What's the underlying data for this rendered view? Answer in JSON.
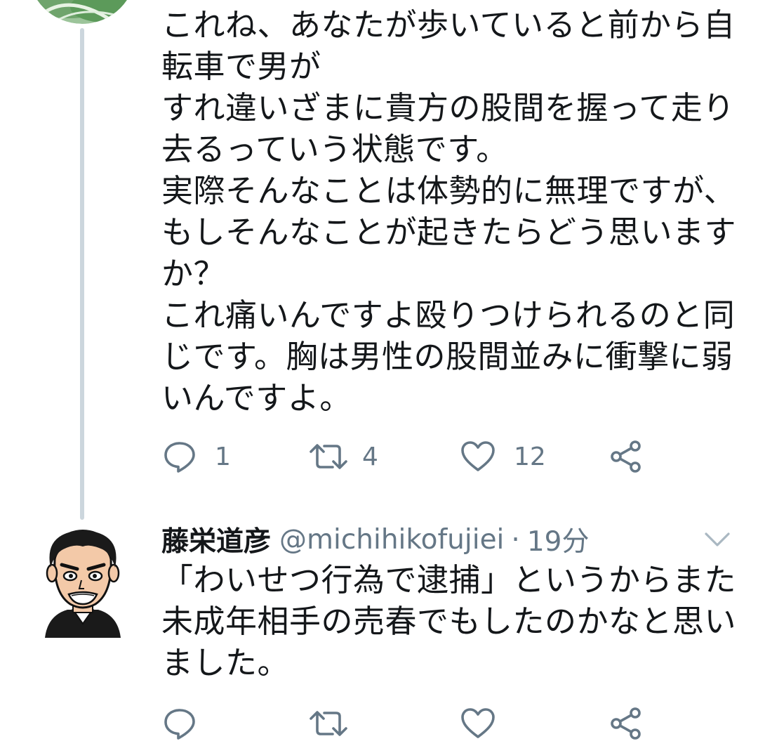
{
  "tweet1": {
    "text": "これね、あなたが歩いていると前から自\n転車で男が\nすれ違いざまに貴方の股間を握って走り\n去るっていう状態です。\n実際そんなことは体勢的に無理ですが、\nもしそんなことが起きたらどう思います\nか？\nこれ痛いんですよ殴りつけられるのと同\nじです。胸は男性の股間並みに衝撃に弱\nいんですよ。",
    "actions": {
      "reply_count": "1",
      "retweet_count": "4",
      "like_count": "12"
    }
  },
  "tweet2": {
    "display_name": "藤栄道彦",
    "handle": "@michihikofujiei",
    "separator": "·",
    "time": "19分",
    "text": "「わいせつ行為で逮捕」というからまた\n未成年相手の売春でもしたのかなと思い\nました。"
  },
  "icons": {
    "reply": "reply-icon",
    "retweet": "retweet-icon",
    "like": "heart-icon",
    "share": "share-icon",
    "menu": "chevron-down-icon"
  },
  "colors": {
    "text": "#14171a",
    "secondary": "#657786",
    "thread_line": "#ccd6dd"
  }
}
